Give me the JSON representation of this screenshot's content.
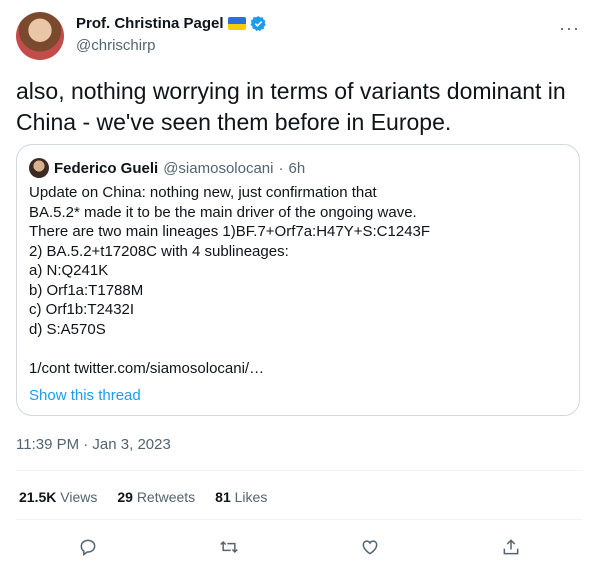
{
  "author": {
    "name": "Prof. Christina Pagel",
    "handle": "@chrischirp"
  },
  "tweet": {
    "text": "also, nothing worrying in terms of variants dominant in China - we've seen them before in Europe."
  },
  "quote": {
    "author_name": "Federico Gueli",
    "author_handle": "@siamosolocani",
    "separator": "·",
    "time": "6h",
    "body": "Update on China: nothing new, just confirmation that\nBA.5.2* made it to be the main driver of the ongoing wave.\nThere are two main lineages 1)BF.7+Orf7a:H47Y+S:C1243F\n2) BA.5.2+t17208C with 4 sublineages:\na) N:Q241K\nb) Orf1a:T1788M\nc) Orf1b:T2432I\nd) S:A570S\n\n1/cont twitter.com/siamosolocani/…",
    "show_thread": "Show this thread"
  },
  "timestamp": "11:39 PM · Jan 3, 2023",
  "stats": {
    "views_count": "21.5K",
    "views_label": "Views",
    "retweets_count": "29",
    "retweets_label": "Retweets",
    "likes_count": "81",
    "likes_label": "Likes"
  },
  "icons": {
    "verified": "verified-badge-icon",
    "flag": "ukraine-flag-icon",
    "more": "more-icon",
    "reply": "reply-icon",
    "retweet": "retweet-icon",
    "like": "like-icon",
    "share": "share-icon"
  },
  "colors": {
    "accent": "#1d9bf0",
    "secondary_text": "#536471",
    "border": "#cfd9de"
  }
}
